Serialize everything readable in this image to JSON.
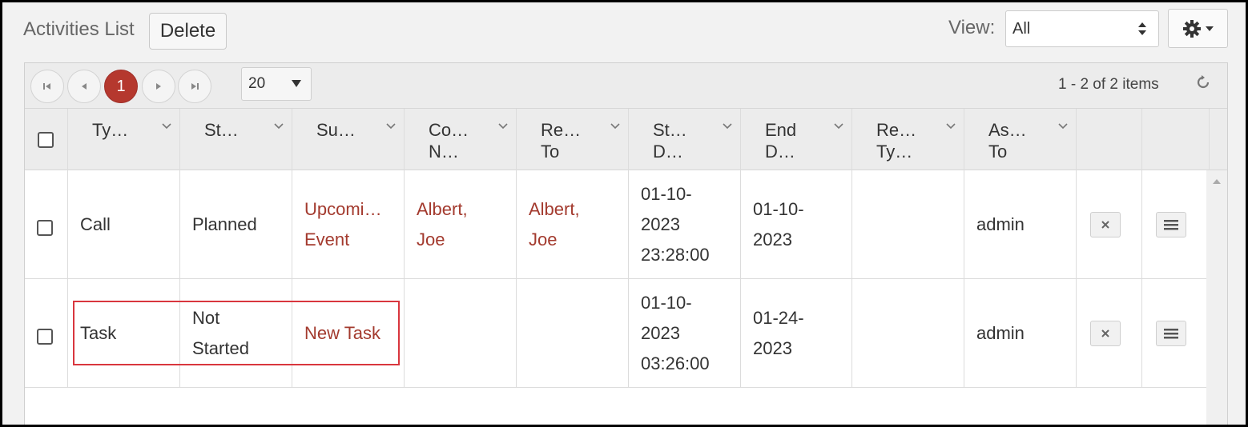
{
  "toolbar": {
    "title": "Activities List",
    "delete_label": "Delete",
    "view_label": "View:",
    "view_value": "All"
  },
  "pager": {
    "current_page": "1",
    "page_size": "20",
    "info": "1 - 2 of 2 items"
  },
  "columns": [
    {
      "line1": "Ty…",
      "line2": ""
    },
    {
      "line1": "St…",
      "line2": ""
    },
    {
      "line1": "Su…",
      "line2": ""
    },
    {
      "line1": "Co…",
      "line2": "N…"
    },
    {
      "line1": "Re…",
      "line2": "To"
    },
    {
      "line1": "St…",
      "line2": "D…"
    },
    {
      "line1": "End",
      "line2": "D…"
    },
    {
      "line1": "Re…",
      "line2": "Ty…"
    },
    {
      "line1": "As…",
      "line2": "To"
    }
  ],
  "rows": [
    {
      "type": "Call",
      "status": "Planned",
      "subject_l1": "Upcomi…",
      "subject_l2": "Event",
      "contact_l1": "Albert,",
      "contact_l2": "Joe",
      "related_l1": "Albert,",
      "related_l2": "Joe",
      "start_l1": "01-10-",
      "start_l2": "2023",
      "start_l3": "23:28:00",
      "end_l1": "01-10-",
      "end_l2": "2023",
      "assigned": "admin"
    },
    {
      "type": "Task",
      "status_l1": "Not",
      "status_l2": "Started",
      "subject": "New Task",
      "start_l1": "01-10-",
      "start_l2": "2023",
      "start_l3": "03:26:00",
      "end_l1": "01-24-",
      "end_l2": "2023",
      "assigned": "admin"
    }
  ],
  "colors": {
    "accent": "#b5382e",
    "link": "#a33a2e",
    "highlight": "#d9363e"
  },
  "icons": [
    "gear-icon",
    "first-page-icon",
    "prev-page-icon",
    "next-page-icon",
    "last-page-icon",
    "refresh-icon",
    "close-icon",
    "hamburger-icon",
    "chevron-down-icon"
  ]
}
